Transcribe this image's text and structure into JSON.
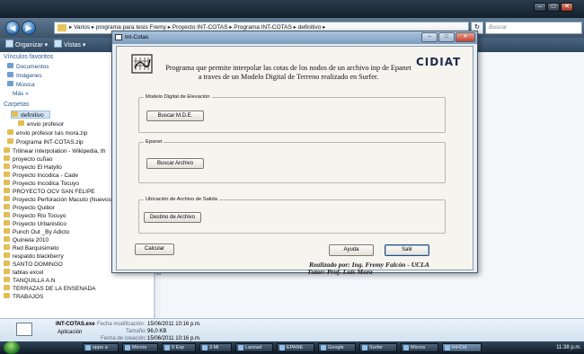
{
  "explorer": {
    "breadcrumb": [
      "Varios",
      "programa para tesis Fremy",
      "Proyecto INT-COTAS",
      "Programa INT-COTAS",
      "definitivo"
    ],
    "breadcrumb_text": "▸ Varios ▸ programa para tesis Fremy ▸ Proyecto INT-COTAS ▸ Programa INT-COTAS ▸ definitivo ▸",
    "search_placeholder": "Buscar",
    "toolbar": {
      "organize": "Organizar ▾",
      "views": "Vistas ▾"
    },
    "left_pane": {
      "favorites_header": "Vínculos favoritos",
      "favorites": [
        "Documentos",
        "Imágenes",
        "Música"
      ],
      "more": "Más »",
      "folders_header": "Carpetas",
      "folders": [
        {
          "label": "definitivo",
          "indent": 3,
          "selected": true
        },
        {
          "label": "envio profesor",
          "indent": 4
        },
        {
          "label": "envio profesor luis mora.zip",
          "indent": 2
        },
        {
          "label": "Programa INT-COTAS.zip",
          "indent": 2
        },
        {
          "label": "Trilinear interpolation - Wikipedia, th",
          "indent": 1
        }
      ]
    },
    "file_list": [
      "proyecto cuñao",
      "Proyecto El Hatyllo",
      "Proyecto Incodica - Cade",
      "Proyecto Incodica Tocuyo",
      "PROYECTO OCV SAN FELIPE",
      "Proyecto Perforación Macuto (Nuevos",
      "Proyecto Quibor",
      "Proyecto Rio Tocuyo",
      "Proyecto Urbanistico",
      "Punch Out _By Adicto",
      "Quiniela 2010",
      "Red Barquisimeto",
      "respaldo blackberry",
      "SANTO DOMINGO",
      "tablas excel",
      "TANQUILLA A.N",
      "TERRAZAS DE LA ENSENADA",
      "TRABAJOS"
    ],
    "details": {
      "name": "INT-COTAS.exe",
      "type": "Aplicación",
      "mod_label": "Fecha modificación:",
      "mod_value": "15/06/2011 10:16 p.m.",
      "size_label": "Tamaño:",
      "size_value": "96,0 KB",
      "created_label": "Fecha de creación:",
      "created_value": "15/06/2011 10:16 p.m."
    }
  },
  "dialog": {
    "title": "Int-Cotas",
    "heading_line1": "Programa que permite interpolar las cotas de los nodos de un archivo inp de Epanet",
    "heading_line2": "a traves de un Modelo Digital de Terreno realizado en Surfer.",
    "logo_text": "CIDIAT",
    "groups": {
      "mde": {
        "label": "Modelo Digital de Elevación",
        "button": "Buscar M.D.E."
      },
      "epanet": {
        "label": "Epanet",
        "button": "Buscar Archivo"
      },
      "salida": {
        "label": "Ubicación de Archivo de Salida",
        "button": "Destino de Archivo"
      }
    },
    "buttons": {
      "calcular": "Calcular",
      "ayuda": "Ayuda",
      "salir": "Salir"
    },
    "credits": {
      "realizado": "Realizado por: Ing. Fremy Falcón - UCLA",
      "tutor": "Tutor: Prof. Luis Mora"
    }
  },
  "taskbar": {
    "tasks": [
      "oppo a",
      "Micros",
      "5 Exp",
      "3 Mi",
      "Lanzad",
      "EPANE",
      "Google",
      "Surfer",
      "Micros",
      "Int-Cot"
    ],
    "clock": "11:38 p.m."
  }
}
